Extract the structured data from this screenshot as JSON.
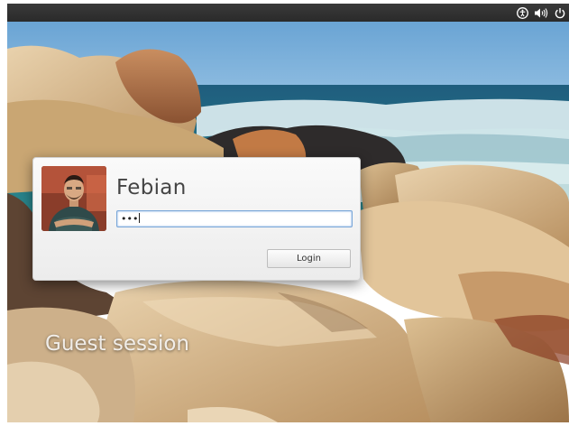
{
  "top_panel": {
    "indicators": [
      "accessibility-icon",
      "volume-icon",
      "power-icon"
    ]
  },
  "login": {
    "username": "Febian",
    "password_value": "•••",
    "login_label": "Login"
  },
  "guest_session_label": "Guest session",
  "colors": {
    "panel": "#2e2e2e",
    "card": "#f4f4f4",
    "focus_border": "#7aa7d8",
    "sky": "#3e87c4",
    "sea": "#2f7c86",
    "rock": "#d7b88b"
  }
}
